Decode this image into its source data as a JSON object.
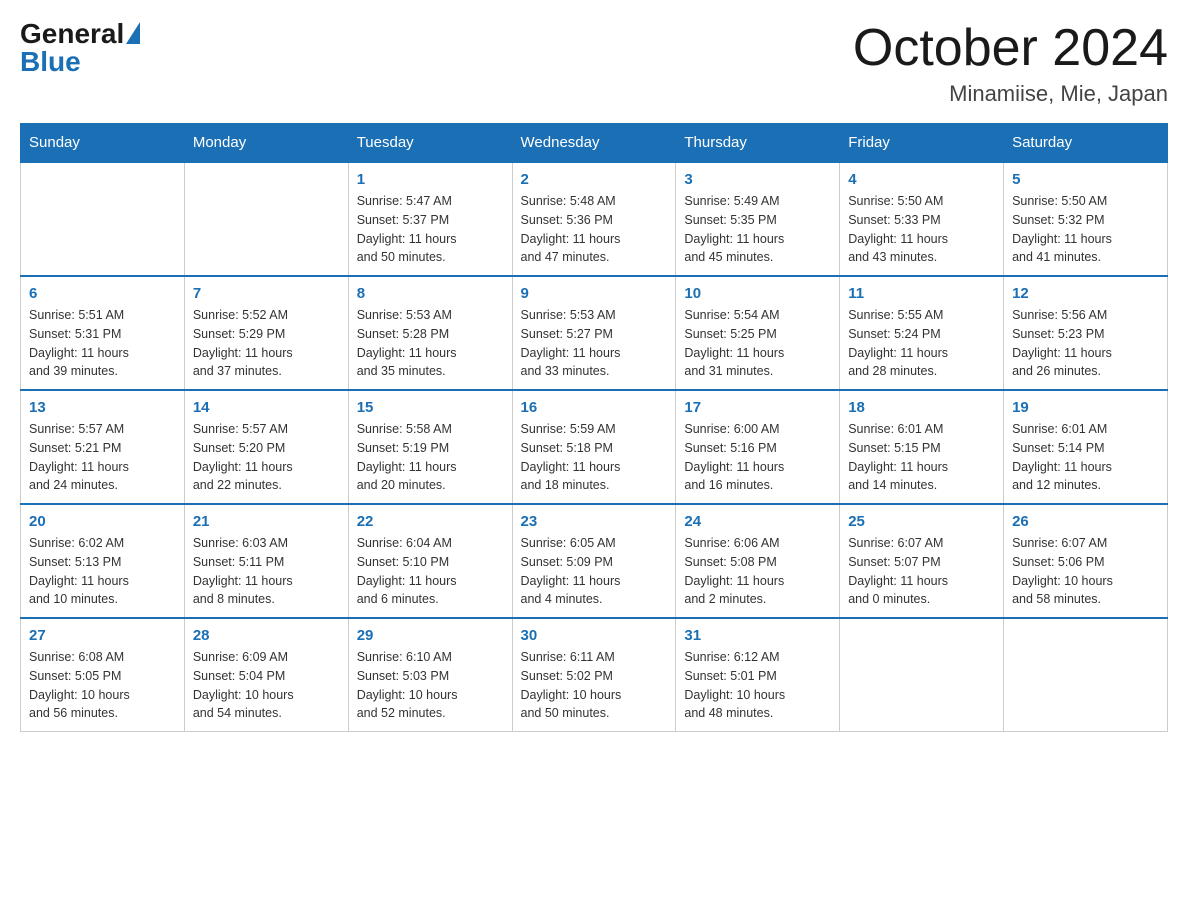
{
  "header": {
    "logo_general": "General",
    "logo_blue": "Blue",
    "month_title": "October 2024",
    "location": "Minamiise, Mie, Japan"
  },
  "days_of_week": [
    "Sunday",
    "Monday",
    "Tuesday",
    "Wednesday",
    "Thursday",
    "Friday",
    "Saturday"
  ],
  "weeks": [
    [
      {
        "day": "",
        "info": ""
      },
      {
        "day": "",
        "info": ""
      },
      {
        "day": "1",
        "info": "Sunrise: 5:47 AM\nSunset: 5:37 PM\nDaylight: 11 hours\nand 50 minutes."
      },
      {
        "day": "2",
        "info": "Sunrise: 5:48 AM\nSunset: 5:36 PM\nDaylight: 11 hours\nand 47 minutes."
      },
      {
        "day": "3",
        "info": "Sunrise: 5:49 AM\nSunset: 5:35 PM\nDaylight: 11 hours\nand 45 minutes."
      },
      {
        "day": "4",
        "info": "Sunrise: 5:50 AM\nSunset: 5:33 PM\nDaylight: 11 hours\nand 43 minutes."
      },
      {
        "day": "5",
        "info": "Sunrise: 5:50 AM\nSunset: 5:32 PM\nDaylight: 11 hours\nand 41 minutes."
      }
    ],
    [
      {
        "day": "6",
        "info": "Sunrise: 5:51 AM\nSunset: 5:31 PM\nDaylight: 11 hours\nand 39 minutes."
      },
      {
        "day": "7",
        "info": "Sunrise: 5:52 AM\nSunset: 5:29 PM\nDaylight: 11 hours\nand 37 minutes."
      },
      {
        "day": "8",
        "info": "Sunrise: 5:53 AM\nSunset: 5:28 PM\nDaylight: 11 hours\nand 35 minutes."
      },
      {
        "day": "9",
        "info": "Sunrise: 5:53 AM\nSunset: 5:27 PM\nDaylight: 11 hours\nand 33 minutes."
      },
      {
        "day": "10",
        "info": "Sunrise: 5:54 AM\nSunset: 5:25 PM\nDaylight: 11 hours\nand 31 minutes."
      },
      {
        "day": "11",
        "info": "Sunrise: 5:55 AM\nSunset: 5:24 PM\nDaylight: 11 hours\nand 28 minutes."
      },
      {
        "day": "12",
        "info": "Sunrise: 5:56 AM\nSunset: 5:23 PM\nDaylight: 11 hours\nand 26 minutes."
      }
    ],
    [
      {
        "day": "13",
        "info": "Sunrise: 5:57 AM\nSunset: 5:21 PM\nDaylight: 11 hours\nand 24 minutes."
      },
      {
        "day": "14",
        "info": "Sunrise: 5:57 AM\nSunset: 5:20 PM\nDaylight: 11 hours\nand 22 minutes."
      },
      {
        "day": "15",
        "info": "Sunrise: 5:58 AM\nSunset: 5:19 PM\nDaylight: 11 hours\nand 20 minutes."
      },
      {
        "day": "16",
        "info": "Sunrise: 5:59 AM\nSunset: 5:18 PM\nDaylight: 11 hours\nand 18 minutes."
      },
      {
        "day": "17",
        "info": "Sunrise: 6:00 AM\nSunset: 5:16 PM\nDaylight: 11 hours\nand 16 minutes."
      },
      {
        "day": "18",
        "info": "Sunrise: 6:01 AM\nSunset: 5:15 PM\nDaylight: 11 hours\nand 14 minutes."
      },
      {
        "day": "19",
        "info": "Sunrise: 6:01 AM\nSunset: 5:14 PM\nDaylight: 11 hours\nand 12 minutes."
      }
    ],
    [
      {
        "day": "20",
        "info": "Sunrise: 6:02 AM\nSunset: 5:13 PM\nDaylight: 11 hours\nand 10 minutes."
      },
      {
        "day": "21",
        "info": "Sunrise: 6:03 AM\nSunset: 5:11 PM\nDaylight: 11 hours\nand 8 minutes."
      },
      {
        "day": "22",
        "info": "Sunrise: 6:04 AM\nSunset: 5:10 PM\nDaylight: 11 hours\nand 6 minutes."
      },
      {
        "day": "23",
        "info": "Sunrise: 6:05 AM\nSunset: 5:09 PM\nDaylight: 11 hours\nand 4 minutes."
      },
      {
        "day": "24",
        "info": "Sunrise: 6:06 AM\nSunset: 5:08 PM\nDaylight: 11 hours\nand 2 minutes."
      },
      {
        "day": "25",
        "info": "Sunrise: 6:07 AM\nSunset: 5:07 PM\nDaylight: 11 hours\nand 0 minutes."
      },
      {
        "day": "26",
        "info": "Sunrise: 6:07 AM\nSunset: 5:06 PM\nDaylight: 10 hours\nand 58 minutes."
      }
    ],
    [
      {
        "day": "27",
        "info": "Sunrise: 6:08 AM\nSunset: 5:05 PM\nDaylight: 10 hours\nand 56 minutes."
      },
      {
        "day": "28",
        "info": "Sunrise: 6:09 AM\nSunset: 5:04 PM\nDaylight: 10 hours\nand 54 minutes."
      },
      {
        "day": "29",
        "info": "Sunrise: 6:10 AM\nSunset: 5:03 PM\nDaylight: 10 hours\nand 52 minutes."
      },
      {
        "day": "30",
        "info": "Sunrise: 6:11 AM\nSunset: 5:02 PM\nDaylight: 10 hours\nand 50 minutes."
      },
      {
        "day": "31",
        "info": "Sunrise: 6:12 AM\nSunset: 5:01 PM\nDaylight: 10 hours\nand 48 minutes."
      },
      {
        "day": "",
        "info": ""
      },
      {
        "day": "",
        "info": ""
      }
    ]
  ]
}
